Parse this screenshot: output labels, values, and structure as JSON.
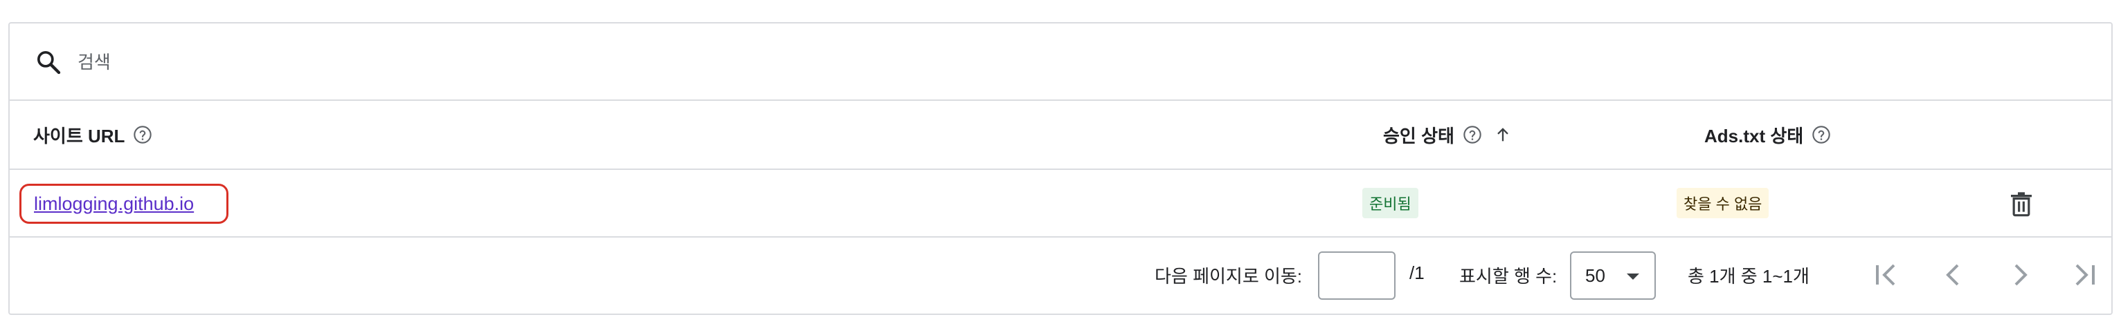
{
  "search": {
    "placeholder": "검색",
    "icon": "search-icon"
  },
  "table": {
    "columns": [
      {
        "label": "사이트 URL",
        "help": true
      },
      {
        "label": "승인 상태",
        "help": true,
        "sorted": "ascending"
      },
      {
        "label": "Ads.txt 상태",
        "help": true
      }
    ],
    "rows": [
      {
        "site_url": "limlogging.github.io",
        "approval_status": "준비됨",
        "ads_txt_status": "찾을 수 없음",
        "action_icon": "trash-icon"
      }
    ]
  },
  "footer": {
    "goto_label": "다음 페이지로 이동:",
    "page_value": "",
    "page_total": "/1",
    "rows_label": "표시할 행 수:",
    "rows_per_page": "50",
    "range_text": "총 1개 중 1~1개"
  },
  "colors": {
    "link": "#5b2fc9",
    "highlight_border": "#d93025",
    "ready_bg": "#e6f4ea",
    "ready_text": "#137333",
    "notfound_bg": "#fef7e0",
    "border": "#dadce0"
  }
}
